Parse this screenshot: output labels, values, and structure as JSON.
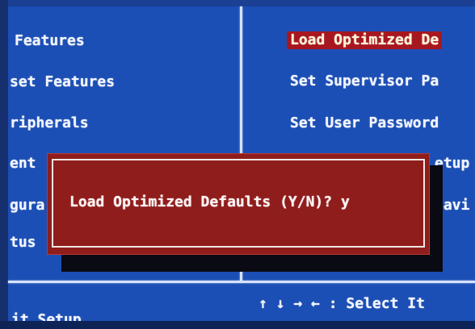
{
  "colors": {
    "background": "#1c4fb5",
    "text": "#f2f5ff",
    "highlight": "#a7171f",
    "dialog": "#8f1d1c",
    "divider": "#d7e2ff"
  },
  "left_menu": {
    "items": [
      {
        "label": "Features"
      },
      {
        "label": "set Features"
      },
      {
        "label": "ripherals"
      },
      {
        "label": "ent"
      },
      {
        "label": "gura"
      },
      {
        "label": "tus"
      }
    ]
  },
  "right_menu": {
    "items": [
      {
        "label": "Load Optimized De",
        "selected": true
      },
      {
        "label": "Set Supervisor Pa"
      },
      {
        "label": "Set User Password"
      },
      {
        "label": "etup"
      },
      {
        "label": "Savi"
      }
    ]
  },
  "dialog": {
    "text": "Load Optimized Defaults (Y/N)? y"
  },
  "footer": {
    "left_text": "it Setup",
    "nav_text": "↑ ↓ → ←   : Select It"
  }
}
